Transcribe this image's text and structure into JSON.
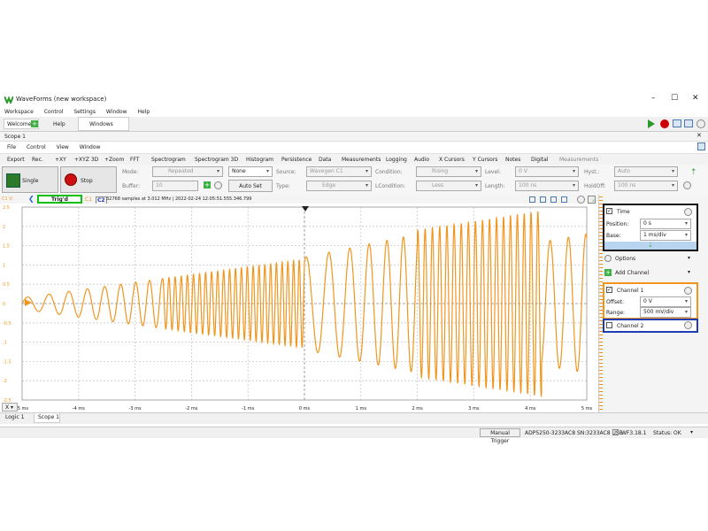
{
  "window": {
    "title": "WaveForms (new workspace)",
    "controls": {
      "minimize": "–",
      "maximize": "☐",
      "close": "✕"
    }
  },
  "main_menu": [
    "Workspace",
    "Control",
    "Settings",
    "Window",
    "Help"
  ],
  "tabs": {
    "welcome": "Welcome",
    "help": "Help",
    "windows": "Windows"
  },
  "scope": {
    "title": "Scope 1",
    "menu": [
      "File",
      "Control",
      "View",
      "Window"
    ],
    "toolbar": [
      "Export",
      "Rec.",
      "+XY",
      "+XYZ 3D",
      "+Zoom",
      "FFT",
      "Spectrogram",
      "Spectrogram 3D",
      "Histogram",
      "Persistence",
      "Data",
      "Measurements",
      "Logging",
      "Audio",
      "X Cursors",
      "Y Cursors",
      "Notes",
      "Digital",
      "Measurements"
    ]
  },
  "acquisition": {
    "single": "Single",
    "stop": "Stop",
    "mode_label": "Mode:",
    "mode_value": "Repeated",
    "buffer_label": "Buffer:",
    "buffer_value": "10",
    "none_value": "None",
    "autoset": "Auto Set",
    "source_label": "Source:",
    "source_value": "Wavegen C1",
    "type_label": "Type:",
    "type_value": "Edge",
    "condition_label": "Condition:",
    "condition_value": "Rising",
    "lcondition_label": "LCondition:",
    "lcondition_value": "Less",
    "level_label": "Level:",
    "level_value": "0 V",
    "length_label": "Length:",
    "length_value": "100 ns",
    "hyst_label": "Hyst.:",
    "hyst_value": "Auto",
    "holdoff_label": "HoldOff:",
    "holdoff_value": "100 ns"
  },
  "status_line": {
    "c1_units": "C1 V:",
    "trig_status": "Trig'd",
    "c1": "C1",
    "c2": "C2",
    "info": "32768 samples at 3.012 MHz | 2022-02-24 12:05:51.555.346.799"
  },
  "colors": {
    "trace": "#f0961e",
    "accent": "#f0961e",
    "panel_blue": "#1e3cb4",
    "trig_green": "#10c010"
  },
  "chart_data": {
    "type": "line",
    "title": "",
    "xlabel": "",
    "ylabel": "",
    "xlim": [
      -5,
      5
    ],
    "ylim": [
      -2.5,
      2.5
    ],
    "x_ticks": [
      "-5 ms",
      "-4 ms",
      "-3 ms",
      "-2 ms",
      "-1 ms",
      "0 ms",
      "1 ms",
      "2 ms",
      "3 ms",
      "4 ms",
      "5 ms"
    ],
    "x_tick_values": [
      -5,
      -4,
      -3,
      -2,
      -1,
      0,
      1,
      2,
      3,
      4,
      5
    ],
    "y_ticks": [
      "2.5",
      "2",
      "1.5",
      "1",
      "0.5",
      "0",
      "-0.5",
      "-1",
      "-1.5",
      "-2",
      "-2.5"
    ],
    "y_tick_values": [
      2.5,
      2,
      1.5,
      1,
      0.5,
      0,
      -0.5,
      -1,
      -1.5,
      -2,
      -2.5
    ],
    "grid": true,
    "series": [
      {
        "color": "#f0961e",
        "segments": [
          {
            "x_start": -5.0,
            "x_end": -2.5,
            "periods": [
              0.4,
              0.22
            ],
            "amplitude": [
              0.15,
              0.65
            ]
          },
          {
            "x_start": -2.5,
            "x_end": 0.0,
            "periods": [
              0.11,
              0.1
            ],
            "amplitude": [
              0.65,
              1.15
            ]
          },
          {
            "x_start": 0.0,
            "x_end": 2.0,
            "periods": [
              0.42,
              0.26
            ],
            "amplitude": [
              1.2,
              1.8
            ]
          },
          {
            "x_start": 2.0,
            "x_end": 4.2,
            "periods": [
              0.13,
              0.12
            ],
            "amplitude": [
              1.9,
              2.4
            ]
          },
          {
            "x_start": 4.2,
            "x_end": 5.0,
            "periods": [
              0.34,
              0.3
            ],
            "amplitude": [
              1.6,
              1.8
            ]
          }
        ]
      }
    ]
  },
  "right_panel": {
    "time": {
      "title": "Time",
      "position_label": "Position:",
      "position_value": "0 s",
      "base_label": "Base:",
      "base_value": "1 ms/div"
    },
    "options": "Options",
    "add_channel": "Add Channel",
    "channel1": {
      "title": "Channel 1",
      "offset_label": "Offset:",
      "offset_value": "0 V",
      "range_label": "Range:",
      "range_value": "500 mV/div"
    },
    "channel2": {
      "title": "Channel 2"
    }
  },
  "bottom": {
    "x_button": "X",
    "bottom_tabs": [
      "Logic 1",
      "Scope 1"
    ],
    "manual_trigger": "Manual Trigger",
    "device": "ADP5250-3233AC8 SN:3233AC8 USB",
    "version": "WF3.18.1",
    "status": "Status: OK"
  }
}
